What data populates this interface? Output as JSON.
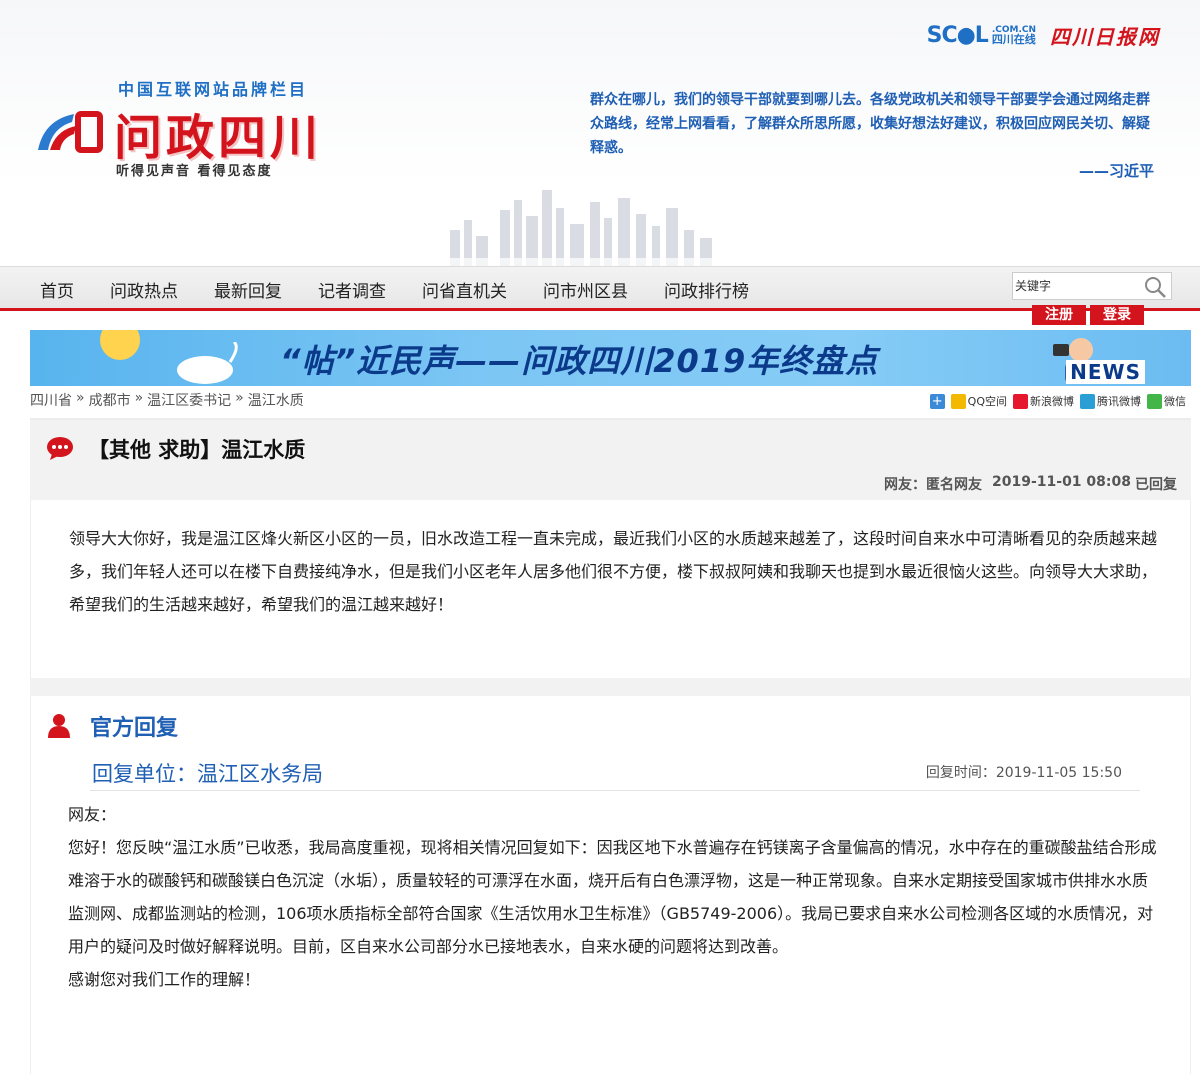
{
  "top_brand": {
    "scol": "SC●L",
    "scol_com": ".COM.CN",
    "scol_cn": "四川在线",
    "newspaper": "四川日报网"
  },
  "logo": {
    "tagline": "中国互联网站品牌栏目",
    "title": "问政四川",
    "slogan": "听得见声音   看得见态度"
  },
  "quote": {
    "text": "群众在哪儿，我们的领导干部就要到哪儿去。各级党政机关和领导干部要学会通过网络走群众路线，经常上网看看，了解群众所思所愿，收集好想法好建议，积极回应网民关切、解疑释惑。",
    "author": "——习近平"
  },
  "nav": {
    "items": [
      "首页",
      "问政热点",
      "最新回复",
      "记者调查",
      "问省直机关",
      "问市州区县",
      "问政排行榜"
    ],
    "search_placeholder": "关键字",
    "register": "注册",
    "login": "登录"
  },
  "banner": {
    "title": "“帖”近民声——问政四川2019年终盘点",
    "news": "NEWS"
  },
  "breadcrumb": [
    "四川省",
    "»",
    "成都市",
    "»",
    "温江区委书记",
    "»",
    "温江水质"
  ],
  "share": [
    "QQ空间",
    "新浪微博",
    "腾讯微博",
    "微信"
  ],
  "question": {
    "title": "【其他 求助】温江水质",
    "user": "网友：匿名网友",
    "datetime": "2019-11-01 08:08",
    "status": "已回复",
    "body": "领导大大你好，我是温江区烽火新区小区的一员，旧水改造工程一直未完成，最近我们小区的水质越来越差了，这段时间自来水中可清晰看见的杂质越来越多，我们年轻人还可以在楼下自费接纯净水，但是我们小区老年人居多他们很不方便，楼下叔叔阿姨和我聊天也提到水最近很恼火这些。向领导大大求助，希望我们的生活越来越好，希望我们的温江越来越好！"
  },
  "reply": {
    "section_title": "官方回复",
    "unit": "回复单位：温江区水务局",
    "time": "回复时间：2019-11-05 15:50",
    "greeting": "网友：",
    "body": "您好！您反映“温江水质”已收悉，我局高度重视，现将相关情况回复如下：因我区地下水普遍存在钙镁离子含量偏高的情况，水中存在的重碳酸盐结合形成难溶于水的碳酸钙和碳酸镁白色沉淀（水垢），质量较轻的可漂浮在水面，烧开后有白色漂浮物，这是一种正常现象。自来水定期接受国家城市供排水水质监测网、成都监测站的检测，106项水质指标全部符合国家《生活饮用水卫生标准》（GB5749-2006）。我局已要求自来水公司检测各区域的水质情况，对用户的疑问及时做好解释说明。目前，区自来水公司部分水已接地表水，自来水硬的问题将达到改善。",
    "closing": "感谢您对我们工作的理解！"
  },
  "colors": {
    "brand_red": "#d4141c",
    "brand_blue": "#1f5fb4"
  }
}
